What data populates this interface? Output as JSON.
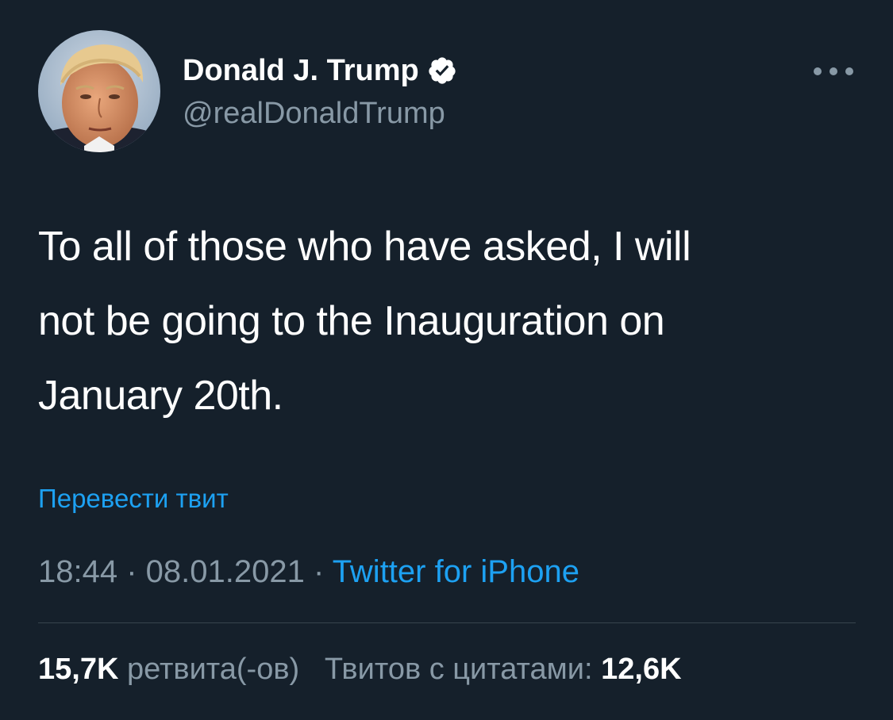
{
  "author": {
    "name": "Donald J. Trump",
    "handle": "@realDonaldTrump",
    "avatar_icon": "profile-photo",
    "verified_icon": "verified-badge-icon"
  },
  "actions": {
    "more_icon": "more-options-icon"
  },
  "tweet": {
    "lines": [
      "To all of those who have asked, I will",
      "not be going to the Inauguration on",
      "January 20th."
    ],
    "translate_label": "Перевести твит"
  },
  "meta": {
    "time": "18:44",
    "separator1": " · ",
    "date": "08.01.2021",
    "separator2": " · ",
    "source": "Twitter for iPhone"
  },
  "stats": {
    "retweets_count": "15,7K",
    "retweets_label": "ретвита(-ов)",
    "quotes_label": "Твитов с цитатами:",
    "quotes_count": "12,6K"
  },
  "colors": {
    "background": "#15202b",
    "primary_text": "#ffffff",
    "secondary_text": "#8899a6",
    "accent": "#1da1f2",
    "divider": "#38444d"
  }
}
